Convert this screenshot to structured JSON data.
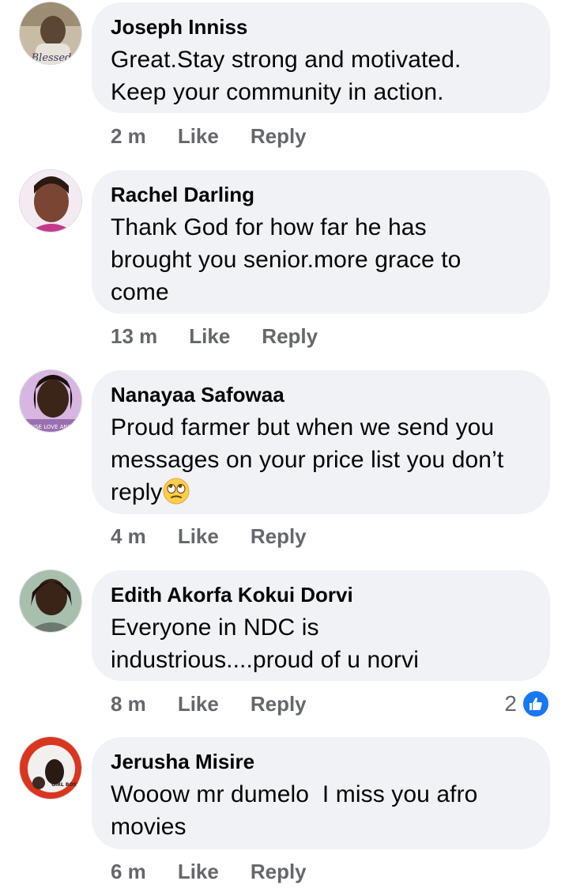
{
  "comments": [
    {
      "author": "Joseph Inniss",
      "lines": [
        "Great.Stay strong and motivated.",
        "Keep your community in action."
      ],
      "time": "2 m",
      "like_label": "Like",
      "reply_label": "Reply",
      "avatar_caption": "Blessed",
      "avatar_colors": [
        "#b8a993",
        "#5b4636"
      ]
    },
    {
      "author": "Rachel Darling",
      "lines": [
        "Thank God for how far he has",
        "brought you senior.more grace to",
        "come"
      ],
      "time": "13 m",
      "like_label": "Like",
      "reply_label": "Reply",
      "avatar_colors": [
        "#f2e6f0",
        "#6b3a2a"
      ]
    },
    {
      "author": "Nanayaa Safowaa",
      "lines": [
        "Proud farmer but when we send you",
        "messages on your price list you don’t",
        "reply"
      ],
      "emoji": "face-with-rolling-eyes-emoji",
      "time": "4 m",
      "like_label": "Like",
      "reply_label": "Reply",
      "avatar_caption": "NSE LOVE AND",
      "avatar_colors": [
        "#c9a3d8",
        "#3b2418"
      ]
    },
    {
      "author": "Edith Akorfa Kokui Dorvi",
      "lines": [
        "Everyone in NDC is",
        "industrious....proud of u norvi"
      ],
      "time": "8 m",
      "like_label": "Like",
      "reply_label": "Reply",
      "reaction_count": "2",
      "avatar_colors": [
        "#9fb6a4",
        "#2c1a12"
      ]
    },
    {
      "author": "Jerusha Misire",
      "lines": [
        "Wooow mr dumelo  I miss you afro",
        "movies"
      ],
      "time": "6 m",
      "like_label": "Like",
      "reply_label": "Reply",
      "avatar_caption": "GIRL BOSS",
      "avatar_colors": [
        "#d9361f",
        "#2a1a14"
      ]
    }
  ],
  "colors": {
    "bubble": "#f0f2f5",
    "meta_text": "#65676b",
    "like_blue": "#1877f2"
  }
}
